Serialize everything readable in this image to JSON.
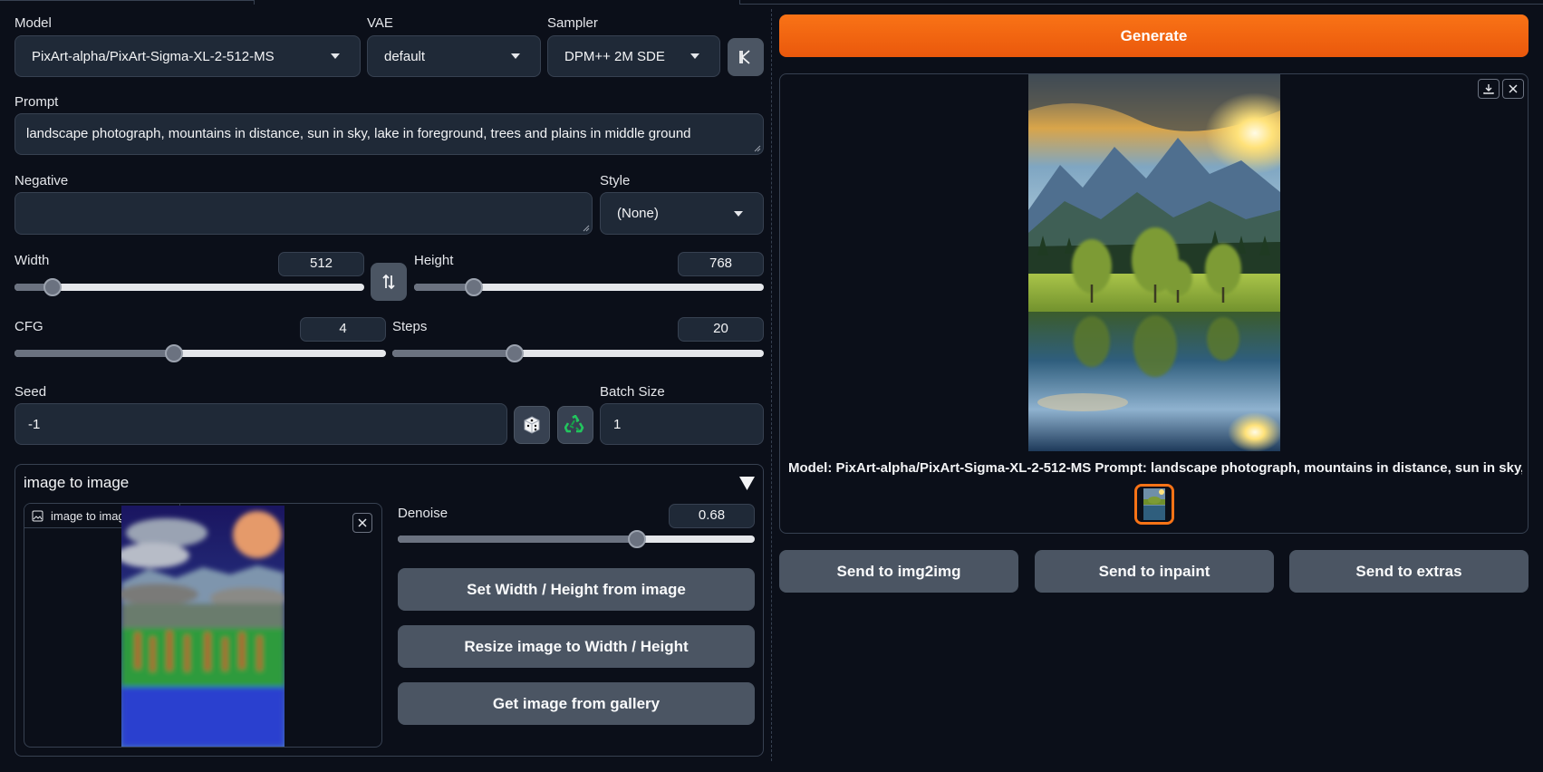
{
  "model": {
    "label": "Model",
    "value": "PixArt-alpha/PixArt-Sigma-XL-2-512-MS"
  },
  "vae": {
    "label": "VAE",
    "value": "default"
  },
  "sampler": {
    "label": "Sampler",
    "value": "DPM++ 2M SDE"
  },
  "prompt": {
    "label": "Prompt",
    "value": "landscape photograph, mountains in distance, sun in sky, lake in foreground, trees and plains in middle ground"
  },
  "negative": {
    "label": "Negative",
    "value": ""
  },
  "style": {
    "label": "Style",
    "value": "(None)"
  },
  "width": {
    "label": "Width",
    "value": "512",
    "fraction": 0.11
  },
  "height": {
    "label": "Height",
    "value": "768",
    "fraction": 0.17
  },
  "cfg": {
    "label": "CFG",
    "value": "4",
    "fraction": 0.43
  },
  "steps": {
    "label": "Steps",
    "value": "20",
    "fraction": 0.33
  },
  "seed": {
    "label": "Seed",
    "value": "-1"
  },
  "batch": {
    "label": "Batch Size",
    "value": "1"
  },
  "img2img": {
    "title": "image to image",
    "source_label": "image to image source",
    "denoise": {
      "label": "Denoise",
      "value": "0.68",
      "fraction": 0.67
    },
    "btn_set_wh": "Set Width / Height from image",
    "btn_resize": "Resize image to Width / Height",
    "btn_gallery": "Get image from gallery"
  },
  "generate_label": "Generate",
  "output_caption": "Model: PixArt-alpha/PixArt-Sigma-XL-2-512-MS Prompt: landscape photograph, mountains in distance, sun in sky, la…",
  "send": {
    "img2img": "Send to img2img",
    "inpaint": "Send to inpaint",
    "extras": "Send to extras"
  },
  "icons": {
    "kolors": "k-icon",
    "swap": "swap-icon",
    "dice": "dice-icon",
    "recycle": "recycle-icon",
    "download": "download-icon",
    "close": "close-icon",
    "image": "image-icon",
    "collapse": "triangle-down-icon"
  },
  "colors": {
    "accent": "#f97316",
    "background": "#0b0f19",
    "panel": "#1f2937",
    "button": "#4b5563"
  }
}
